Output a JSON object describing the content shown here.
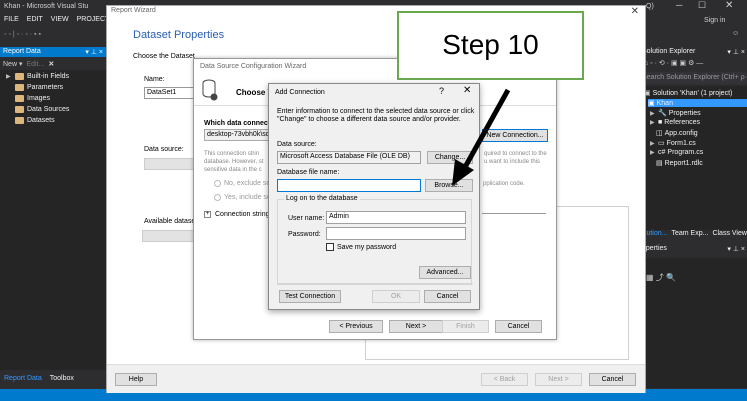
{
  "vs": {
    "title": "Khan - Microsoft Visual Stu",
    "menu": [
      "FILE",
      "EDIT",
      "VIEW",
      "PROJECT"
    ],
    "toolbar_text": "◦ ◦ | ◦ · ◦ · ▪ ▪",
    "left_panel": {
      "title": "Report Data",
      "pins": "▾ ⊥ ×",
      "new_label": "New ▾",
      "edit_label": "Edit...",
      "tree": [
        "Built-in Fields",
        "Parameters",
        "Images",
        "Data Sources",
        "Datasets"
      ],
      "tabs": [
        "Report Data",
        "Toolbox"
      ]
    },
    "right": {
      "signin": "Sign in",
      "qcorner": "Q)",
      "solution_explorer_title": "Solution Explorer",
      "se_pins": "▾ ⊥ ×",
      "search_placeholder": "Search Solution Explorer (Ctrl+ ρ·",
      "solution_label": "Solution 'Khan' (1 project)",
      "project": "Khan",
      "items": [
        "Properties",
        "References",
        "App.config",
        "Form1.cs",
        "Program.cs",
        "Report1.rdlc"
      ],
      "tabs": [
        "olution...",
        "Team Exp...",
        "Class View"
      ],
      "properties_title": "operties",
      "prop_pins": "▾ ⊥ ×"
    }
  },
  "report_wizard": {
    "title": "Report Wizard",
    "heading": "Dataset Properties",
    "choose": "Choose the Dataset",
    "name_label": "Name:",
    "name_value": "DataSet1",
    "data_source_label": "Data source:",
    "available_datasets_label": "Available datasets",
    "buttons": {
      "help": "Help",
      "back": "< Back",
      "next": "Next >",
      "cancel": "Cancel"
    }
  },
  "dscw": {
    "title": "Data Source Configuration Wizard",
    "heading": "Choose Y",
    "which": "Which data connectio",
    "server_value": "desktop-73vbh0k\\sqle",
    "new_connection": "New Connection...",
    "desc_left": "This connection strin\ndatabase. However, st\nsensitive data in the c",
    "desc_right": "quired to connect to the\nu want to include this",
    "radio_no": "No, exclude sen",
    "radio_yes": "Yes, include sen",
    "app_code": "pplication code.",
    "conn_string": "Connection string",
    "buttons": {
      "previous": "< Previous",
      "next": "Next >",
      "finish": "Finish",
      "cancel": "Cancel"
    }
  },
  "add_connection": {
    "title": "Add Connection",
    "help": "?",
    "close": "✕",
    "instructions": "Enter information to connect to the selected data source or click \"Change\" to choose a different data source and/or provider.",
    "data_source_label": "Data source:",
    "data_source_value": "Microsoft Access Database File (OLE DB)",
    "change_button": "Change...",
    "db_file_label": "Database file name:",
    "db_file_value": "",
    "browse_button": "Browse...",
    "logon_group": "Log on to the database",
    "username_label": "User name:",
    "username_value": "Admin",
    "password_label": "Password:",
    "password_value": "",
    "save_password": "Save my password",
    "advanced_button": "Advanced...",
    "test_button": "Test Connection",
    "ok_button": "OK",
    "cancel_button": "Cancel"
  },
  "callout": {
    "text": "Step 10"
  },
  "colors": {
    "accent": "#007acc",
    "heading_blue": "#2a5db0",
    "callout_border": "#6aa84f",
    "vs_dark": "#2d2d30"
  }
}
